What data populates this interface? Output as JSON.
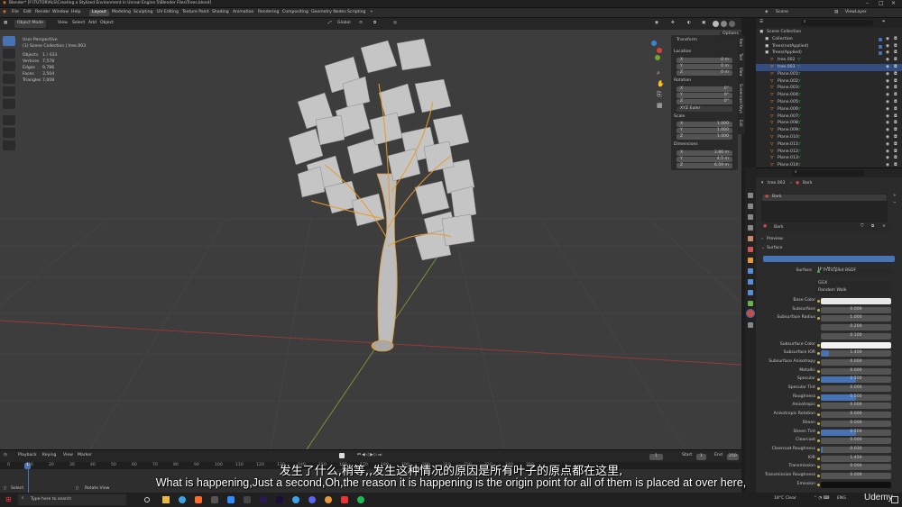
{
  "window": {
    "title": "Blender* [F:\\TUTORIALS\\Creating a Stylized Environment in Unreal Engine 5\\Blender Files\\Trees.blend]"
  },
  "menus": [
    "File",
    "Edit",
    "Render",
    "Window",
    "Help"
  ],
  "workspaces": [
    "Layout",
    "Modeling",
    "Sculpting",
    "UV Editing",
    "Texture Paint",
    "Shading",
    "Animation",
    "Rendering",
    "Compositing",
    "Geometry Nodes",
    "Scripting"
  ],
  "active_workspace": "Layout",
  "scene": {
    "name": "Scene",
    "view_layer": "ViewLayer"
  },
  "viewport": {
    "mode": "Object Mode",
    "menus": [
      "View",
      "Select",
      "Add",
      "Object"
    ],
    "transform_orientation": "Global",
    "options_label": "Options",
    "perspective": "User Perspective",
    "collection_line": "(1) Scene Collection | tree.003",
    "stats": [
      {
        "label": "Objects",
        "value": "1 / 433"
      },
      {
        "label": "Vertices",
        "value": "7,578"
      },
      {
        "label": "Edges",
        "value": "9,786"
      },
      {
        "label": "Faces",
        "value": "3,504"
      },
      {
        "label": "Triangles",
        "value": "7,008"
      }
    ]
  },
  "npanel": {
    "title": "Transform",
    "location_label": "Location",
    "location": [
      [
        "X",
        "0 m"
      ],
      [
        "Y",
        "0 m"
      ],
      [
        "Z",
        "0 m"
      ]
    ],
    "rotation_label": "Rotation",
    "rotation": [
      [
        "X",
        "0°"
      ],
      [
        "Y",
        "0°"
      ],
      [
        "Z",
        "0°"
      ]
    ],
    "rotation_mode": "XYZ Euler",
    "scale_label": "Scale",
    "scale": [
      [
        "X",
        "1.000"
      ],
      [
        "Y",
        "1.000"
      ],
      [
        "Z",
        "1.000"
      ]
    ],
    "dimensions_label": "Dimensions",
    "dimensions": [
      [
        "X",
        "3.86 m"
      ],
      [
        "Y",
        "4.5 m"
      ],
      [
        "Z",
        "6.59 m"
      ]
    ],
    "tabs": [
      "Item",
      "Tool",
      "View",
      "Screencast Keys",
      "Edit"
    ]
  },
  "timeline": {
    "menus": [
      "Playback",
      "Keying",
      "View",
      "Marker"
    ],
    "current_frame": "1",
    "start_label": "Start",
    "start": "1",
    "end_label": "End",
    "end": "250",
    "ticks": [
      "0",
      "10",
      "20",
      "30",
      "40",
      "50",
      "60",
      "70",
      "80",
      "90",
      "100",
      "110",
      "120",
      "130",
      "140",
      "150",
      "160",
      "170",
      "180",
      "190",
      "200",
      "210",
      "220",
      "230",
      "240",
      "250"
    ],
    "status_select": "Select",
    "status_rotate": "Rotate View"
  },
  "outliner": {
    "search_placeholder": "",
    "items": [
      "Scene Collection",
      "Collection",
      "Trees(notApplied)",
      "Trees(Applied)",
      "tree.002",
      "tree.003",
      "Plane.001",
      "Plane.002",
      "Plane.003",
      "Plane.004",
      "Plane.005",
      "Plane.006",
      "Plane.007",
      "Plane.008",
      "Plane.009",
      "Plane.010",
      "Plane.011",
      "Plane.012",
      "Plane.013",
      "Plane.014"
    ]
  },
  "properties": {
    "object": "tree.003",
    "material_slot": "Bark",
    "material_name": "Bark",
    "preview_label": "Preview",
    "surface_section": "Surface",
    "use_nodes": "Use Nodes",
    "surface_label": "Surface",
    "surface_value": "Principled BSDF",
    "distribution": "GGX",
    "subsurface_method": "Random Walk",
    "rows": [
      {
        "label": "Base Color",
        "value": "",
        "fill": 1.0,
        "color": "#e8e8e8"
      },
      {
        "label": "Subsurface",
        "value": "0.000",
        "fill": 0
      },
      {
        "label": "Subsurface Radius",
        "value": "1.000",
        "fill": 0
      },
      {
        "label": "",
        "value": "0.200",
        "fill": 0
      },
      {
        "label": "",
        "value": "0.100",
        "fill": 0
      },
      {
        "label": "Subsurface Color",
        "value": "",
        "fill": 1.0,
        "color": "#f2f2f2"
      },
      {
        "label": "Subsurface IOR",
        "value": "1.400",
        "fill": 0.12
      },
      {
        "label": "Subsurface Anisotropy",
        "value": "0.000",
        "fill": 0
      },
      {
        "label": "Metallic",
        "value": "0.000",
        "fill": 0
      },
      {
        "label": "Specular",
        "value": "0.500",
        "fill": 0.5
      },
      {
        "label": "Specular Tint",
        "value": "0.000",
        "fill": 0
      },
      {
        "label": "Roughness",
        "value": "0.500",
        "fill": 0.5
      },
      {
        "label": "Anisotropic",
        "value": "0.000",
        "fill": 0
      },
      {
        "label": "Anisotropic Rotation",
        "value": "0.000",
        "fill": 0
      },
      {
        "label": "Sheen",
        "value": "0.000",
        "fill": 0
      },
      {
        "label": "Sheen Tint",
        "value": "0.500",
        "fill": 0.5
      },
      {
        "label": "Clearcoat",
        "value": "0.000",
        "fill": 0
      },
      {
        "label": "Clearcoat Roughness",
        "value": "0.030",
        "fill": 0.03
      },
      {
        "label": "IOR",
        "value": "1.450",
        "fill": 0
      },
      {
        "label": "Transmission",
        "value": "0.000",
        "fill": 0
      },
      {
        "label": "Transmission Roughness",
        "value": "0.000",
        "fill": 0
      },
      {
        "label": "Emission",
        "value": "",
        "fill": 1.0,
        "color": "#101010"
      }
    ]
  },
  "subtitles": {
    "zh": "发生了什么,稍等,,发生这种情况的原因是所有叶子的原点都在这里,",
    "en": "What is happening,Just a second,Oh,the reason it is happening is the origin point for all of them is placed at over here,"
  },
  "taskbar": {
    "search_placeholder": "Type here to search",
    "weather": "18°C Clear",
    "lang": "ENG",
    "watermark": "Udemy"
  },
  "colors": {
    "accent": "#4772b3",
    "selection_orange": "#e89b2a",
    "viewport_bg": "#3d3d3d"
  }
}
